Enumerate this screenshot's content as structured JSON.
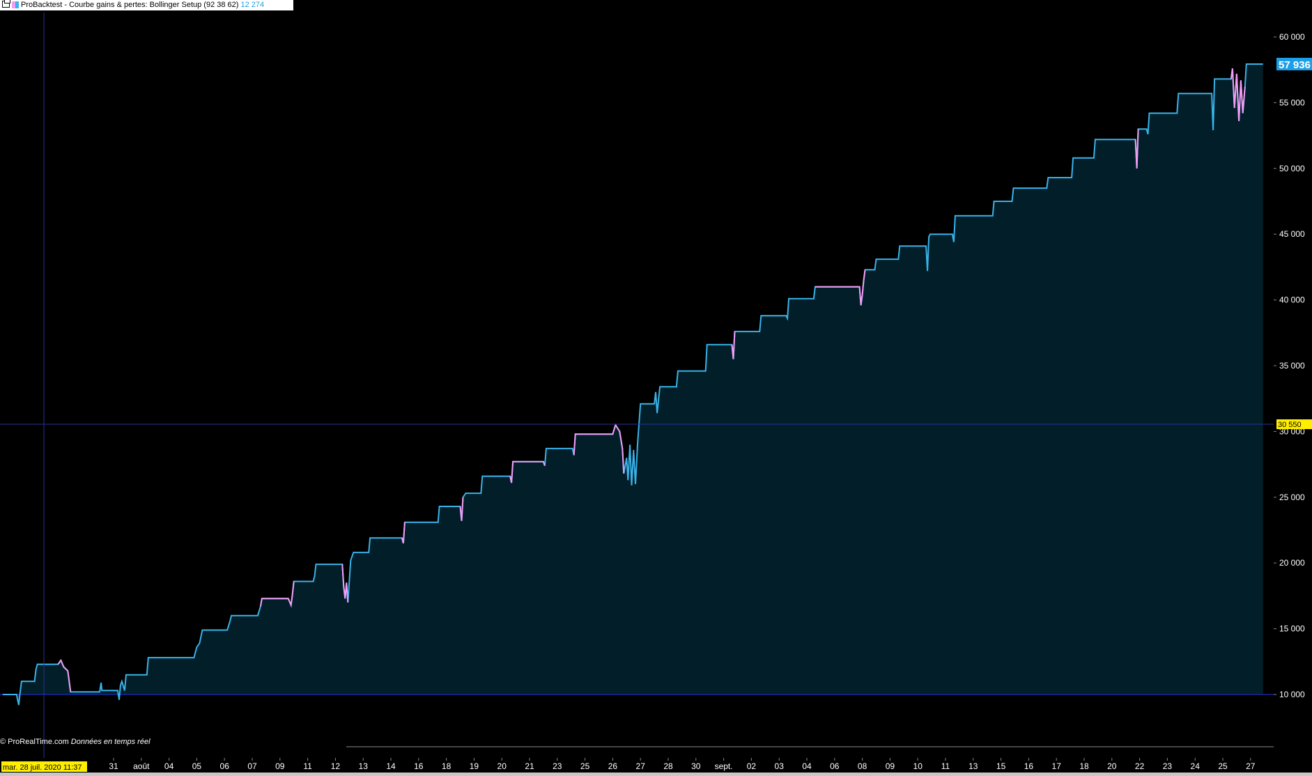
{
  "window": {
    "title": "ProBacktest - Courbe gains & pertes: Bollinger Setup (92 38 62)",
    "value": "12 274"
  },
  "footer": {
    "copyright": "© ProRealTime.com",
    "realtime": "Données en temps réel"
  },
  "crosshair": {
    "date_label": "mar. 28 juil. 2020 11:37",
    "value_label": "30 550",
    "value": 30550
  },
  "last_value_label": "57 936",
  "colors": {
    "equity_line": "#39b3ea",
    "drawdown_line": "#f29cf5",
    "area_fill": "#021f29",
    "baseline": "#1a2dbb",
    "crosshair": "#2a2f9a",
    "last_value_bg": "#1d9fe8",
    "crosshair_label_bg": "#ffee00"
  },
  "chart_data": {
    "type": "area",
    "title": "Courbe gains & pertes: Bollinger Setup (92 38 62)",
    "ylim": [
      6000,
      62000
    ],
    "y_ticks": [
      10000,
      15000,
      20000,
      25000,
      30000,
      35000,
      40000,
      45000,
      50000,
      55000,
      60000
    ],
    "y_tick_labels": [
      "10 000",
      "15 000",
      "20 000",
      "25 000",
      "30 000",
      "35 000",
      "40 000",
      "45 000",
      "50 000",
      "55 000",
      "60 000"
    ],
    "baseline": 10000,
    "x_tick_labels": [
      "31",
      "août",
      "04",
      "05",
      "06",
      "07",
      "09",
      "11",
      "12",
      "13",
      "14",
      "16",
      "18",
      "19",
      "20",
      "21",
      "23",
      "25",
      "26",
      "27",
      "28",
      "30",
      "sept.",
      "02",
      "03",
      "04",
      "06",
      "08",
      "09",
      "10",
      "11",
      "13",
      "15",
      "16",
      "17",
      "18",
      "20",
      "22",
      "23",
      "24",
      "25",
      "27"
    ],
    "x_tick_index": [
      4,
      5,
      6,
      7,
      8,
      9,
      10,
      11,
      12,
      13,
      14,
      15,
      16,
      17,
      18,
      19,
      20,
      21,
      22,
      23,
      24,
      25,
      26,
      27,
      28,
      29,
      30,
      31,
      32,
      33,
      34,
      35,
      36,
      37,
      38,
      39,
      40,
      41,
      42,
      43,
      44,
      45
    ],
    "x_range": [
      0,
      46
    ],
    "series": [
      {
        "values": [
          [
            0.0,
            10000
          ],
          [
            0.5,
            10000
          ],
          [
            0.58,
            9200
          ],
          [
            0.62,
            10000
          ],
          [
            0.68,
            11000
          ],
          [
            1.15,
            11000
          ],
          [
            1.2,
            11900
          ],
          [
            1.25,
            12300
          ],
          [
            2.0,
            12300
          ],
          [
            2.1,
            12600
          ],
          [
            2.2,
            12100
          ],
          [
            2.35,
            11800
          ],
          [
            2.45,
            10200
          ],
          [
            3.5,
            10200
          ],
          [
            3.55,
            10900
          ],
          [
            3.58,
            10300
          ],
          [
            4.15,
            10300
          ],
          [
            4.2,
            9600
          ],
          [
            4.25,
            10700
          ],
          [
            4.3,
            11000
          ],
          [
            4.4,
            10300
          ],
          [
            4.45,
            11500
          ],
          [
            5.2,
            11500
          ],
          [
            5.25,
            12800
          ],
          [
            6.9,
            12800
          ],
          [
            7.0,
            13600
          ],
          [
            7.1,
            13900
          ],
          [
            7.2,
            14900
          ],
          [
            8.1,
            14900
          ],
          [
            8.2,
            15600
          ],
          [
            8.25,
            16000
          ],
          [
            9.2,
            16000
          ],
          [
            9.3,
            16700
          ],
          [
            9.35,
            17300
          ],
          [
            10.3,
            17300
          ],
          [
            10.4,
            16800
          ],
          [
            10.45,
            17600
          ],
          [
            10.5,
            18600
          ],
          [
            11.2,
            18600
          ],
          [
            11.25,
            19000
          ],
          [
            11.3,
            19900
          ],
          [
            12.25,
            19900
          ],
          [
            12.3,
            18200
          ],
          [
            12.35,
            17300
          ],
          [
            12.4,
            18500
          ],
          [
            12.45,
            17000
          ],
          [
            12.55,
            20200
          ],
          [
            12.65,
            20800
          ],
          [
            13.2,
            20800
          ],
          [
            13.25,
            21900
          ],
          [
            14.4,
            21900
          ],
          [
            14.45,
            21500
          ],
          [
            14.5,
            23100
          ],
          [
            15.7,
            23100
          ],
          [
            15.75,
            24300
          ],
          [
            16.5,
            24300
          ],
          [
            16.55,
            23200
          ],
          [
            16.6,
            25000
          ],
          [
            16.7,
            25300
          ],
          [
            17.25,
            25300
          ],
          [
            17.3,
            26600
          ],
          [
            18.3,
            26600
          ],
          [
            18.35,
            26100
          ],
          [
            18.4,
            27700
          ],
          [
            19.5,
            27700
          ],
          [
            19.55,
            27400
          ],
          [
            19.6,
            28700
          ],
          [
            20.55,
            28700
          ],
          [
            20.6,
            28200
          ],
          [
            20.65,
            29800
          ],
          [
            22.0,
            29800
          ],
          [
            22.1,
            30500
          ],
          [
            22.25,
            30000
          ],
          [
            22.35,
            28700
          ],
          [
            22.4,
            26800
          ],
          [
            22.5,
            28000
          ],
          [
            22.55,
            26300
          ],
          [
            22.62,
            29000
          ],
          [
            22.68,
            25900
          ],
          [
            22.75,
            28600
          ],
          [
            22.82,
            26000
          ],
          [
            22.9,
            29200
          ],
          [
            23.0,
            32100
          ],
          [
            23.5,
            32100
          ],
          [
            23.55,
            33000
          ],
          [
            23.6,
            31400
          ],
          [
            23.7,
            33400
          ],
          [
            24.3,
            33400
          ],
          [
            24.35,
            34600
          ],
          [
            25.35,
            34600
          ],
          [
            25.4,
            36600
          ],
          [
            26.3,
            36600
          ],
          [
            26.35,
            35500
          ],
          [
            26.4,
            37600
          ],
          [
            27.3,
            37600
          ],
          [
            27.35,
            38800
          ],
          [
            28.25,
            38800
          ],
          [
            28.3,
            38600
          ],
          [
            28.35,
            40100
          ],
          [
            29.25,
            40100
          ],
          [
            29.3,
            41000
          ],
          [
            30.9,
            41000
          ],
          [
            30.95,
            39600
          ],
          [
            31.0,
            40400
          ],
          [
            31.05,
            41500
          ],
          [
            31.1,
            42300
          ],
          [
            31.45,
            42300
          ],
          [
            31.5,
            43100
          ],
          [
            32.3,
            43100
          ],
          [
            32.35,
            44100
          ],
          [
            33.3,
            44100
          ],
          [
            33.35,
            42200
          ],
          [
            33.4,
            44800
          ],
          [
            33.45,
            45000
          ],
          [
            34.25,
            45000
          ],
          [
            34.3,
            44400
          ],
          [
            34.35,
            46400
          ],
          [
            35.7,
            46400
          ],
          [
            35.75,
            47500
          ],
          [
            36.4,
            47500
          ],
          [
            36.45,
            48500
          ],
          [
            37.65,
            48500
          ],
          [
            37.7,
            49300
          ],
          [
            38.55,
            49300
          ],
          [
            38.6,
            50800
          ],
          [
            39.35,
            50800
          ],
          [
            39.4,
            52200
          ],
          [
            40.85,
            52200
          ],
          [
            40.9,
            50000
          ],
          [
            40.95,
            53000
          ],
          [
            41.25,
            53000
          ],
          [
            41.3,
            52600
          ],
          [
            41.35,
            54200
          ],
          [
            42.35,
            54200
          ],
          [
            42.4,
            55700
          ],
          [
            43.6,
            55700
          ],
          [
            43.65,
            52900
          ],
          [
            43.7,
            56800
          ],
          [
            44.3,
            56800
          ],
          [
            44.35,
            57600
          ],
          [
            44.42,
            54600
          ],
          [
            44.5,
            57200
          ],
          [
            44.58,
            53600
          ],
          [
            44.65,
            56700
          ],
          [
            44.72,
            54200
          ],
          [
            44.8,
            56200
          ],
          [
            44.85,
            57936
          ],
          [
            45.45,
            57936
          ]
        ]
      }
    ],
    "drawdown_segments": [
      [
        2.0,
        2.45
      ],
      [
        9.3,
        10.5
      ],
      [
        12.25,
        12.5
      ],
      [
        14.4,
        14.5
      ],
      [
        16.5,
        16.6
      ],
      [
        18.3,
        19.55
      ],
      [
        20.6,
        22.1
      ],
      [
        22.1,
        22.4
      ],
      [
        26.3,
        26.4
      ],
      [
        29.3,
        31.1
      ],
      [
        40.85,
        40.95
      ],
      [
        44.3,
        44.8
      ]
    ]
  }
}
